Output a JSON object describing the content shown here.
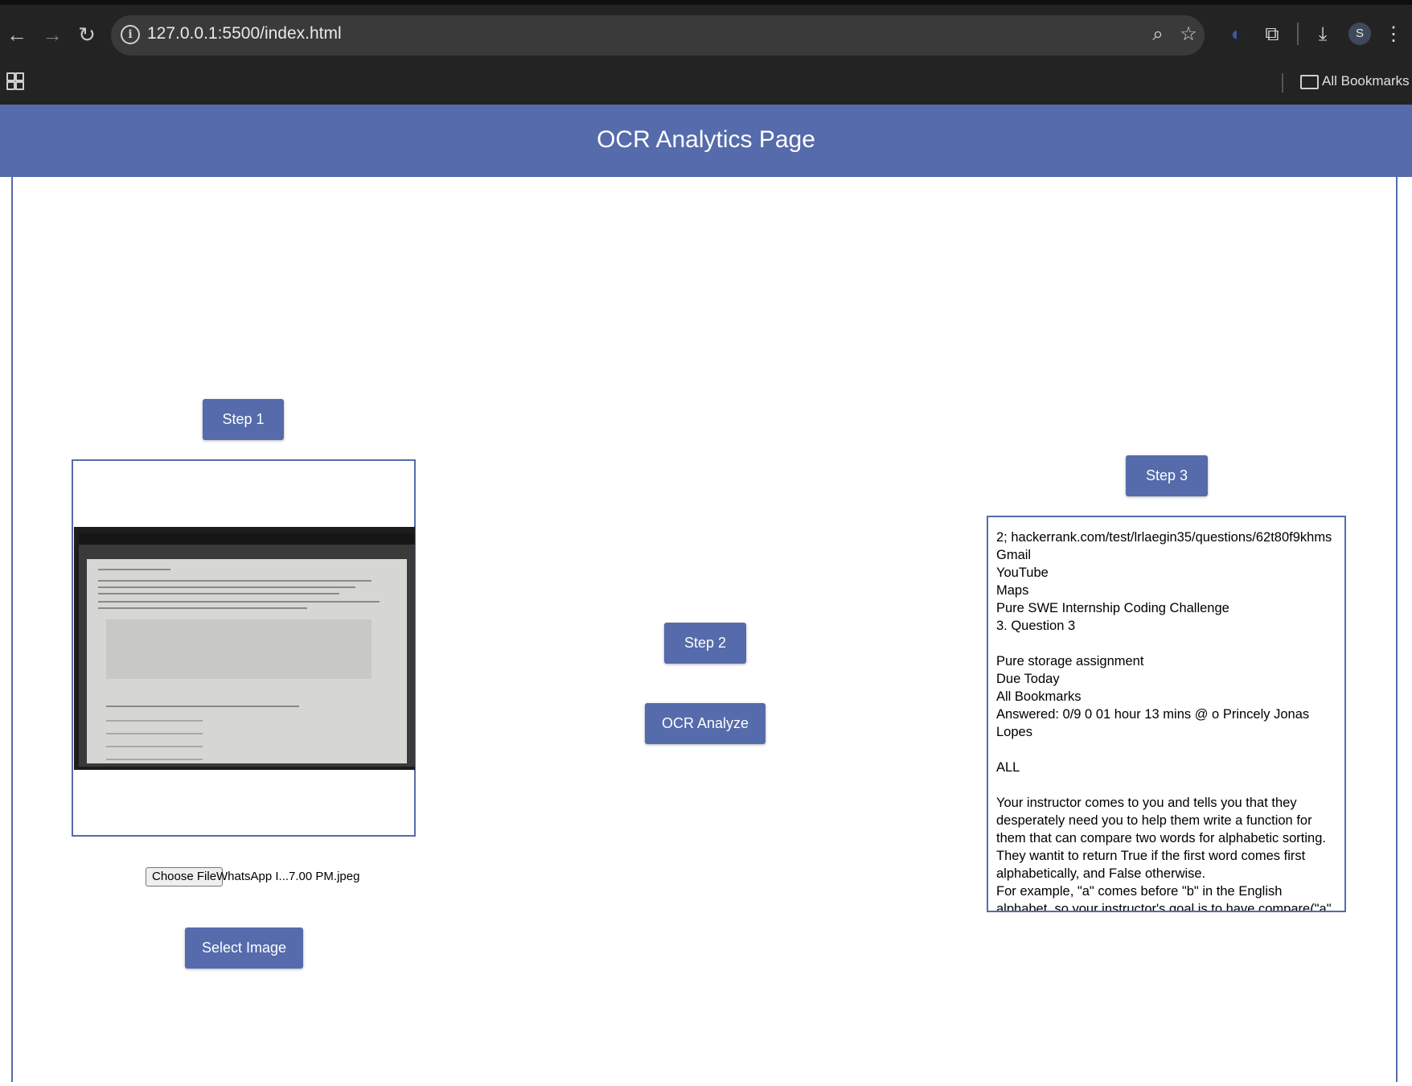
{
  "browser": {
    "url": "127.0.0.1:5500/index.html",
    "bookmarks_label": "All Bookmarks",
    "profile_initial": "S"
  },
  "page": {
    "title": "OCR Analytics Page"
  },
  "step1": {
    "button_label": "Step 1",
    "choose_file_label": "Choose File",
    "file_name": "WhatsApp I...7.00 PM.jpeg",
    "select_image_label": "Select Image"
  },
  "step2": {
    "button_label": "Step 2",
    "analyze_label": "OCR Analyze"
  },
  "step3": {
    "button_label": "Step 3",
    "ocr_text": "2; hackerrank.com/test/lrlaegin35/questions/62t80f9khms\nGmail\nYouTube\nMaps\nPure SWE Internship Coding Challenge\n3. Question 3\n\nPure storage assignment\nDue Today\nAll Bookmarks\nAnswered: 0/9 0 01 hour 13 mins @ o Princely Jonas Lopes\n\nALL\n\nYour instructor comes to you and tells you that they desperately need you to help them write a function for them that can compare two words for alphabetic sorting. They wantit to return True if the first word comes first alphabetically, and False otherwise.\nFor example, \"a\" comes before \"b\" in the English alphabet, so your instructor's goal is to have compare(\"a\", \"b\") return True.\nKnowing that you're brilliant, your instructor would like you to"
  },
  "colors": {
    "accent": "#556bab",
    "chrome_bg": "#232323",
    "omnibox_bg": "#3a3a3a"
  }
}
